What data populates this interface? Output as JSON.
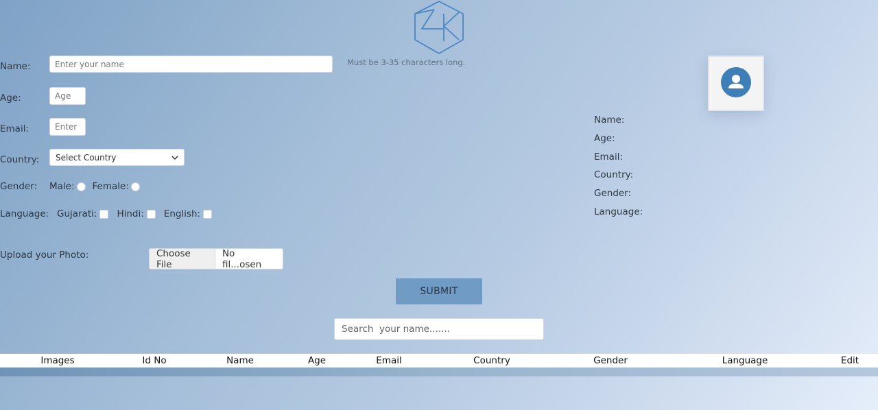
{
  "form": {
    "name_label": "Name:",
    "name_placeholder": "Enter your name",
    "name_hint": "Must be 3-35 characters long.",
    "age_label": "Age:",
    "age_placeholder": "Age",
    "email_label": "Email:",
    "email_placeholder": "Enter y",
    "country_label": "Country:",
    "country_selected": "Select Country",
    "gender_label": "Gender:",
    "gender_options": [
      "Male:",
      "Female:"
    ],
    "language_label": "Language:",
    "language_options": [
      "Gujarati:",
      "Hindi:",
      "English:"
    ],
    "upload_label": "Upload your Photo:",
    "file_button": "Choose File",
    "file_status": "No fil...osen",
    "submit_label": "SUBMIT"
  },
  "search": {
    "placeholder": "Search  your name......."
  },
  "preview": {
    "fields": [
      "Name:",
      "Age:",
      "Email:",
      "Country:",
      "Gender:",
      "Language:"
    ]
  },
  "table": {
    "headers": [
      "Images",
      "Id No",
      "Name",
      "Age",
      "Email",
      "Country",
      "Gender",
      "Language",
      "Edit"
    ]
  },
  "colors": {
    "logo": "#4a86c5",
    "avatar": "#3d7fb6",
    "submit": "#6f9bc4"
  },
  "icons": {
    "logo": "hexagon-logo-icon",
    "avatar": "user-avatar-icon",
    "dropdown": "chevron-down-icon"
  }
}
